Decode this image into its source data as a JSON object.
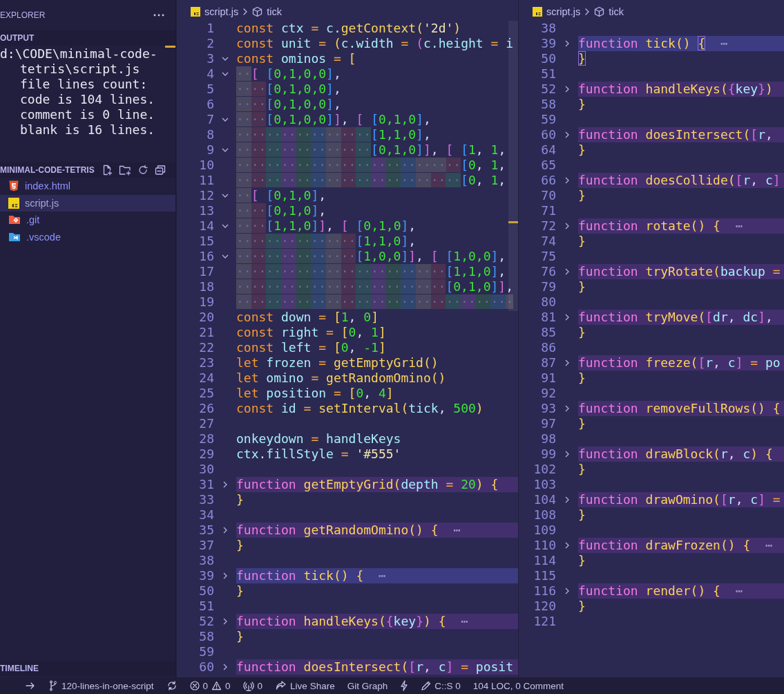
{
  "sidebar": {
    "title": "EXPLORER",
    "output": {
      "title": "OUTPUT",
      "lines": [
        "d:\\CODE\\minimal-code-",
        "tetris\\script.js",
        "file lines count:",
        "code is 104 lines.",
        "comment is 0 line.",
        "blank is 16 lines."
      ]
    },
    "folder": {
      "title": "MINIMAL-CODE-TETRIS",
      "items": [
        {
          "name": "index.html",
          "kind": "html",
          "selected": false
        },
        {
          "name": "script.js",
          "kind": "js",
          "selected": true
        },
        {
          "name": ".git",
          "kind": "git",
          "selected": false
        },
        {
          "name": ".vscode",
          "kind": "vscode",
          "selected": false
        }
      ]
    },
    "timeline": {
      "title": "TIMELINE"
    }
  },
  "editors": [
    {
      "breadcrumb": {
        "file": "script.js",
        "symbol": "tick"
      },
      "lines": [
        {
          "number": "1",
          "selected": false,
          "tokens": [
            {
              "text": "const ",
              "kind": "kw"
            },
            {
              "text": "ctx",
              "kind": "var"
            },
            {
              "text": " = ",
              "kind": "op"
            },
            {
              "text": "c.",
              "kind": "var"
            },
            {
              "text": "getContext",
              "kind": "call"
            },
            {
              "text": "(",
              "kind": "br0"
            },
            {
              "text": "'2d'",
              "kind": "str"
            },
            {
              "text": ")",
              "kind": "br0"
            }
          ]
        },
        {
          "number": "2",
          "selected": false,
          "tokens": [
            {
              "text": "const ",
              "kind": "kw"
            },
            {
              "text": "unit",
              "kind": "var"
            },
            {
              "text": " = ",
              "kind": "op"
            },
            {
              "text": "(",
              "kind": "br0"
            },
            {
              "text": "c.width",
              "kind": "var"
            },
            {
              "text": " = ",
              "kind": "op"
            },
            {
              "text": "(",
              "kind": "br1"
            },
            {
              "text": "c.height",
              "kind": "var"
            },
            {
              "text": " = ",
              "kind": "op"
            },
            {
              "text": "i",
              "kind": "var"
            }
          ]
        },
        {
          "number": "3",
          "selected": false,
          "folded": false,
          "tokens": [
            {
              "text": "const ",
              "kind": "kw"
            },
            {
              "text": "ominos",
              "kind": "var"
            },
            {
              "text": " = ",
              "kind": "op"
            },
            {
              "text": "[",
              "kind": "br0"
            }
          ]
        },
        {
          "number": "4",
          "selected": false,
          "folded": false,
          "tokens": [
            {
              "text": "··",
              "kind": "ws"
            },
            {
              "text": "[ ",
              "kind": "br1"
            },
            {
              "text": "[",
              "kind": "br2"
            },
            {
              "text": "0,1,0,0",
              "kind": "num"
            },
            {
              "text": "]",
              "kind": "br2"
            },
            {
              "text": ",",
              "kind": "punc"
            }
          ]
        },
        {
          "number": "5",
          "selected": false,
          "tokens": [
            {
              "text": "····",
              "kind": "ws"
            },
            {
              "text": "[",
              "kind": "br2"
            },
            {
              "text": "0,1,0,0",
              "kind": "num"
            },
            {
              "text": "]",
              "kind": "br2"
            },
            {
              "text": ",",
              "kind": "punc"
            }
          ]
        },
        {
          "number": "6",
          "selected": false,
          "tokens": [
            {
              "text": "····",
              "kind": "ws"
            },
            {
              "text": "[",
              "kind": "br2"
            },
            {
              "text": "0,1,0,0",
              "kind": "num"
            },
            {
              "text": "]",
              "kind": "br2"
            },
            {
              "text": ",",
              "kind": "punc"
            }
          ]
        },
        {
          "number": "7",
          "selected": false,
          "folded": false,
          "tokens": [
            {
              "text": "····",
              "kind": "ws"
            },
            {
              "text": "[",
              "kind": "br2"
            },
            {
              "text": "0,1,0,0",
              "kind": "num"
            },
            {
              "text": "]",
              "kind": "br2"
            },
            {
              "text": "]",
              "kind": "br1"
            },
            {
              "text": ", ",
              "kind": "punc"
            },
            {
              "text": "[ ",
              "kind": "br1"
            },
            {
              "text": "[",
              "kind": "br2"
            },
            {
              "text": "0,1,0",
              "kind": "num"
            },
            {
              "text": "]",
              "kind": "br2"
            },
            {
              "text": ",",
              "kind": "punc"
            }
          ]
        },
        {
          "number": "8",
          "selected": false,
          "tokens": [
            {
              "text": "··················",
              "kind": "ws"
            },
            {
              "text": "[",
              "kind": "br2"
            },
            {
              "text": "1,1,0",
              "kind": "num"
            },
            {
              "text": "]",
              "kind": "br2"
            },
            {
              "text": ",",
              "kind": "punc"
            }
          ]
        },
        {
          "number": "9",
          "selected": false,
          "folded": false,
          "tokens": [
            {
              "text": "··················",
              "kind": "ws"
            },
            {
              "text": "[",
              "kind": "br2"
            },
            {
              "text": "0,1,0",
              "kind": "num"
            },
            {
              "text": "]",
              "kind": "br2"
            },
            {
              "text": "]",
              "kind": "br1"
            },
            {
              "text": ", ",
              "kind": "punc"
            },
            {
              "text": "[ ",
              "kind": "br1"
            },
            {
              "text": "[",
              "kind": "br2"
            },
            {
              "text": "1",
              "kind": "num"
            },
            {
              "text": ", ",
              "kind": "punc"
            },
            {
              "text": "1",
              "kind": "num"
            },
            {
              "text": ",",
              "kind": "punc"
            }
          ]
        },
        {
          "number": "10",
          "selected": false,
          "tokens": [
            {
              "text": "··························",
              "kind": "ws"
            },
            {
              "text": "····",
              "kind": "ws"
            },
            {
              "text": "[",
              "kind": "br2"
            },
            {
              "text": "0",
              "kind": "num"
            },
            {
              "text": ", ",
              "kind": "punc"
            },
            {
              "text": "1",
              "kind": "num"
            },
            {
              "text": ",",
              "kind": "punc"
            }
          ]
        },
        {
          "number": "11",
          "selected": false,
          "tokens": [
            {
              "text": "······························",
              "kind": "ws"
            },
            {
              "text": "[",
              "kind": "br2"
            },
            {
              "text": "0",
              "kind": "num"
            },
            {
              "text": ", ",
              "kind": "punc"
            },
            {
              "text": "1",
              "kind": "num"
            },
            {
              "text": ",",
              "kind": "punc"
            }
          ]
        },
        {
          "number": "12",
          "selected": false,
          "folded": false,
          "tokens": [
            {
              "text": "··",
              "kind": "ws"
            },
            {
              "text": "[ ",
              "kind": "br1"
            },
            {
              "text": "[",
              "kind": "br2"
            },
            {
              "text": "0,1,0",
              "kind": "num"
            },
            {
              "text": "]",
              "kind": "br2"
            },
            {
              "text": ",",
              "kind": "punc"
            }
          ]
        },
        {
          "number": "13",
          "selected": false,
          "tokens": [
            {
              "text": "····",
              "kind": "ws"
            },
            {
              "text": "[",
              "kind": "br2"
            },
            {
              "text": "0,1,0",
              "kind": "num"
            },
            {
              "text": "]",
              "kind": "br2"
            },
            {
              "text": ",",
              "kind": "punc"
            }
          ]
        },
        {
          "number": "14",
          "selected": false,
          "folded": false,
          "tokens": [
            {
              "text": "····",
              "kind": "ws"
            },
            {
              "text": "[",
              "kind": "br2"
            },
            {
              "text": "1,1,0",
              "kind": "num"
            },
            {
              "text": "]",
              "kind": "br2"
            },
            {
              "text": "]",
              "kind": "br1"
            },
            {
              "text": ", ",
              "kind": "punc"
            },
            {
              "text": "[ ",
              "kind": "br1"
            },
            {
              "text": "[",
              "kind": "br2"
            },
            {
              "text": "0,1,0",
              "kind": "num"
            },
            {
              "text": "]",
              "kind": "br2"
            },
            {
              "text": ",",
              "kind": "punc"
            }
          ]
        },
        {
          "number": "15",
          "selected": false,
          "tokens": [
            {
              "text": "················",
              "kind": "ws"
            },
            {
              "text": "[",
              "kind": "br2"
            },
            {
              "text": "1,1,0",
              "kind": "num"
            },
            {
              "text": "]",
              "kind": "br2"
            },
            {
              "text": ",",
              "kind": "punc"
            }
          ]
        },
        {
          "number": "16",
          "selected": false,
          "folded": false,
          "tokens": [
            {
              "text": "················",
              "kind": "ws"
            },
            {
              "text": "[",
              "kind": "br2"
            },
            {
              "text": "1,0,0",
              "kind": "num"
            },
            {
              "text": "]",
              "kind": "br2"
            },
            {
              "text": "]",
              "kind": "br1"
            },
            {
              "text": ", ",
              "kind": "punc"
            },
            {
              "text": "[ ",
              "kind": "br1"
            },
            {
              "text": "[",
              "kind": "br2"
            },
            {
              "text": "1,0,0",
              "kind": "num"
            },
            {
              "text": "]",
              "kind": "br2"
            },
            {
              "text": ",",
              "kind": "punc"
            }
          ]
        },
        {
          "number": "17",
          "selected": false,
          "tokens": [
            {
              "text": "····························",
              "kind": "ws"
            },
            {
              "text": "[",
              "kind": "br2"
            },
            {
              "text": "1,1,0",
              "kind": "num"
            },
            {
              "text": "]",
              "kind": "br2"
            },
            {
              "text": ",",
              "kind": "punc"
            }
          ]
        },
        {
          "number": "18",
          "selected": false,
          "tokens": [
            {
              "text": "····························",
              "kind": "ws"
            },
            {
              "text": "[",
              "kind": "br2"
            },
            {
              "text": "0,1,0",
              "kind": "num"
            },
            {
              "text": "]",
              "kind": "br2"
            },
            {
              "text": "]",
              "kind": "br1"
            },
            {
              "text": ",",
              "kind": "punc"
            }
          ]
        },
        {
          "number": "19",
          "selected": false,
          "tokens": [
            {
              "text": "·····································",
              "kind": "ws"
            }
          ]
        },
        {
          "number": "20",
          "selected": false,
          "tokens": [
            {
              "text": "const ",
              "kind": "kw"
            },
            {
              "text": "down",
              "kind": "var"
            },
            {
              "text": " = ",
              "kind": "op"
            },
            {
              "text": "[",
              "kind": "br0"
            },
            {
              "text": "1",
              "kind": "num"
            },
            {
              "text": ", ",
              "kind": "punc"
            },
            {
              "text": "0",
              "kind": "num"
            },
            {
              "text": "]",
              "kind": "br0"
            }
          ]
        },
        {
          "number": "21",
          "selected": false,
          "tokens": [
            {
              "text": "const ",
              "kind": "kw"
            },
            {
              "text": "right",
              "kind": "var"
            },
            {
              "text": " = ",
              "kind": "op"
            },
            {
              "text": "[",
              "kind": "br0"
            },
            {
              "text": "0",
              "kind": "num"
            },
            {
              "text": ", ",
              "kind": "punc"
            },
            {
              "text": "1",
              "kind": "num"
            },
            {
              "text": "]",
              "kind": "br0"
            }
          ]
        },
        {
          "number": "22",
          "selected": false,
          "tokens": [
            {
              "text": "const ",
              "kind": "kw"
            },
            {
              "text": "left",
              "kind": "var"
            },
            {
              "text": " = ",
              "kind": "op"
            },
            {
              "text": "[",
              "kind": "br0"
            },
            {
              "text": "0",
              "kind": "num"
            },
            {
              "text": ", ",
              "kind": "punc"
            },
            {
              "text": "-1",
              "kind": "num"
            },
            {
              "text": "]",
              "kind": "br0"
            }
          ]
        },
        {
          "number": "23",
          "selected": false,
          "tokens": [
            {
              "text": "let ",
              "kind": "kw"
            },
            {
              "text": "frozen",
              "kind": "var"
            },
            {
              "text": " = ",
              "kind": "op"
            },
            {
              "text": "getEmptyGrid",
              "kind": "call"
            },
            {
              "text": "()",
              "kind": "br0"
            }
          ]
        },
        {
          "number": "24",
          "selected": false,
          "tokens": [
            {
              "text": "let ",
              "kind": "kw"
            },
            {
              "text": "omino",
              "kind": "var"
            },
            {
              "text": " = ",
              "kind": "op"
            },
            {
              "text": "getRandomOmino",
              "kind": "call"
            },
            {
              "text": "()",
              "kind": "br0"
            }
          ]
        },
        {
          "number": "25",
          "selected": false,
          "tokens": [
            {
              "text": "let ",
              "kind": "kw"
            },
            {
              "text": "position",
              "kind": "var"
            },
            {
              "text": " = ",
              "kind": "op"
            },
            {
              "text": "[",
              "kind": "br0"
            },
            {
              "text": "0",
              "kind": "num"
            },
            {
              "text": ", ",
              "kind": "punc"
            },
            {
              "text": "4",
              "kind": "num"
            },
            {
              "text": "]",
              "kind": "br0"
            }
          ]
        },
        {
          "number": "26",
          "selected": false,
          "tokens": [
            {
              "text": "const ",
              "kind": "kw"
            },
            {
              "text": "id",
              "kind": "var"
            },
            {
              "text": " = ",
              "kind": "op"
            },
            {
              "text": "setInterval",
              "kind": "call"
            },
            {
              "text": "(",
              "kind": "br0"
            },
            {
              "text": "tick",
              "kind": "var"
            },
            {
              "text": ", ",
              "kind": "punc"
            },
            {
              "text": "500",
              "kind": "num"
            },
            {
              "text": ")",
              "kind": "br0"
            }
          ]
        },
        {
          "number": "27",
          "selected": false
        },
        {
          "number": "28",
          "selected": false,
          "tokens": [
            {
              "text": "onkeydown",
              "kind": "var"
            },
            {
              "text": " = ",
              "kind": "op"
            },
            {
              "text": "handleKeys",
              "kind": "var"
            }
          ]
        },
        {
          "number": "29",
          "selected": false,
          "tokens": [
            {
              "text": "ctx",
              "kind": "var"
            },
            {
              "text": ".",
              "kind": "punc"
            },
            {
              "text": "fillStyle",
              "kind": "var"
            },
            {
              "text": " = ",
              "kind": "op"
            },
            {
              "text": "'#555'",
              "kind": "str"
            }
          ]
        },
        {
          "number": "30",
          "selected": false
        },
        {
          "number": "31",
          "selected": false,
          "folded": true,
          "tokens": [
            {
              "text": "function ",
              "kind": "fn"
            },
            {
              "text": "getEmptyGrid",
              "kind": "call"
            },
            {
              "text": "(",
              "kind": "br0"
            },
            {
              "text": "depth",
              "kind": "var"
            },
            {
              "text": " = ",
              "kind": "op"
            },
            {
              "text": "20",
              "kind": "num"
            },
            {
              "text": ")",
              "kind": "br0"
            },
            {
              "text": " {",
              "kind": "br0"
            }
          ]
        },
        {
          "number": "33",
          "selected": false,
          "tokens": [
            {
              "text": "}",
              "kind": "br0"
            }
          ]
        },
        {
          "number": "34",
          "selected": false
        },
        {
          "number": "35",
          "selected": false,
          "folded": true,
          "tokens": [
            {
              "text": "function ",
              "kind": "fn"
            },
            {
              "text": "getRandomOmino",
              "kind": "call"
            },
            {
              "text": "()",
              "kind": "br0"
            },
            {
              "text": " {",
              "kind": "br0"
            },
            {
              "text": "  ⋯",
              "kind": "ell"
            }
          ]
        },
        {
          "number": "37",
          "selected": false,
          "tokens": [
            {
              "text": "}",
              "kind": "br0"
            }
          ]
        },
        {
          "number": "38",
          "selected": false
        },
        {
          "number": "39",
          "selected": true,
          "folded": true,
          "tokens": [
            {
              "text": "function ",
              "kind": "fn"
            },
            {
              "text": "tick",
              "kind": "call"
            },
            {
              "text": "()",
              "kind": "br0"
            },
            {
              "text": " {",
              "kind": "br0"
            },
            {
              "text": "  ⋯",
              "kind": "ell"
            }
          ]
        },
        {
          "number": "50",
          "selected": false,
          "tokens": [
            {
              "text": "}",
              "kind": "br0"
            }
          ]
        },
        {
          "number": "51",
          "selected": false
        },
        {
          "number": "52",
          "selected": false,
          "folded": true,
          "tokens": [
            {
              "text": "function ",
              "kind": "fn"
            },
            {
              "text": "handleKeys",
              "kind": "call"
            },
            {
              "text": "(",
              "kind": "br0"
            },
            {
              "text": "{",
              "kind": "br1"
            },
            {
              "text": "key",
              "kind": "var"
            },
            {
              "text": "}",
              "kind": "br1"
            },
            {
              "text": ")",
              "kind": "br0"
            },
            {
              "text": " {",
              "kind": "br0"
            },
            {
              "text": "  ⋯",
              "kind": "ell"
            }
          ]
        },
        {
          "number": "58",
          "selected": false,
          "tokens": [
            {
              "text": "}",
              "kind": "br0"
            }
          ]
        },
        {
          "number": "59",
          "selected": false
        },
        {
          "number": "60",
          "selected": false,
          "folded": true,
          "tokens": [
            {
              "text": "function ",
              "kind": "fn"
            },
            {
              "text": "doesIntersect",
              "kind": "call"
            },
            {
              "text": "(",
              "kind": "br0"
            },
            {
              "text": "[",
              "kind": "br1"
            },
            {
              "text": "r",
              "kind": "var"
            },
            {
              "text": ", ",
              "kind": "punc"
            },
            {
              "text": "c",
              "kind": "var"
            },
            {
              "text": "]",
              "kind": "br1"
            },
            {
              "text": " = ",
              "kind": "op"
            },
            {
              "text": "posit",
              "kind": "var"
            }
          ]
        }
      ]
    },
    {
      "breadcrumb": {
        "file": "script.js",
        "symbol": "tick"
      },
      "lines": [
        {
          "number": "38",
          "selected": false
        },
        {
          "number": "39",
          "selected": true,
          "folded": true,
          "tokens": [
            {
              "text": "function ",
              "kind": "fn"
            },
            {
              "text": "tick",
              "kind": "call"
            },
            {
              "text": "() ",
              "kind": "br0"
            },
            {
              "text": "{",
              "kind": "match"
            },
            {
              "text": "  ⋯",
              "kind": "ell"
            }
          ]
        },
        {
          "number": "50",
          "selected": false,
          "tokens": [
            {
              "text": "}",
              "kind": "match"
            }
          ]
        },
        {
          "number": "51",
          "selected": false
        },
        {
          "number": "52",
          "selected": false,
          "folded": true,
          "tokens": [
            {
              "text": "function ",
              "kind": "fn"
            },
            {
              "text": "handleKeys",
              "kind": "call"
            },
            {
              "text": "(",
              "kind": "br0"
            },
            {
              "text": "{",
              "kind": "br1"
            },
            {
              "text": "key",
              "kind": "var"
            },
            {
              "text": "}",
              "kind": "br1"
            },
            {
              "text": ")",
              "kind": "br0"
            }
          ]
        },
        {
          "number": "58",
          "selected": false,
          "tokens": [
            {
              "text": "}",
              "kind": "br0"
            }
          ]
        },
        {
          "number": "59",
          "selected": false
        },
        {
          "number": "60",
          "selected": false,
          "folded": true,
          "tokens": [
            {
              "text": "function ",
              "kind": "fn"
            },
            {
              "text": "doesIntersect",
              "kind": "call"
            },
            {
              "text": "(",
              "kind": "br0"
            },
            {
              "text": "[",
              "kind": "br1"
            },
            {
              "text": "r",
              "kind": "var"
            },
            {
              "text": ",",
              "kind": "punc"
            }
          ]
        },
        {
          "number": "64",
          "selected": false,
          "tokens": [
            {
              "text": "}",
              "kind": "br0"
            }
          ]
        },
        {
          "number": "65",
          "selected": false
        },
        {
          "number": "66",
          "selected": false,
          "folded": true,
          "tokens": [
            {
              "text": "function ",
              "kind": "fn"
            },
            {
              "text": "doesCollide",
              "kind": "call"
            },
            {
              "text": "(",
              "kind": "br0"
            },
            {
              "text": "[",
              "kind": "br1"
            },
            {
              "text": "r",
              "kind": "var"
            },
            {
              "text": ", ",
              "kind": "punc"
            },
            {
              "text": "c",
              "kind": "var"
            },
            {
              "text": "]",
              "kind": "br1"
            }
          ]
        },
        {
          "number": "70",
          "selected": false,
          "tokens": [
            {
              "text": "}",
              "kind": "br0"
            }
          ]
        },
        {
          "number": "71",
          "selected": false
        },
        {
          "number": "72",
          "selected": false,
          "folded": true,
          "tokens": [
            {
              "text": "function ",
              "kind": "fn"
            },
            {
              "text": "rotate",
              "kind": "call"
            },
            {
              "text": "()",
              "kind": "br0"
            },
            {
              "text": " {",
              "kind": "br0"
            },
            {
              "text": "  ⋯",
              "kind": "ell"
            }
          ]
        },
        {
          "number": "74",
          "selected": false,
          "tokens": [
            {
              "text": "}",
              "kind": "br0"
            }
          ]
        },
        {
          "number": "75",
          "selected": false
        },
        {
          "number": "76",
          "selected": false,
          "folded": true,
          "tokens": [
            {
              "text": "function ",
              "kind": "fn"
            },
            {
              "text": "tryRotate",
              "kind": "call"
            },
            {
              "text": "(",
              "kind": "br0"
            },
            {
              "text": "backup",
              "kind": "var"
            },
            {
              "text": " =",
              "kind": "op"
            }
          ]
        },
        {
          "number": "79",
          "selected": false,
          "tokens": [
            {
              "text": "}",
              "kind": "br0"
            }
          ]
        },
        {
          "number": "80",
          "selected": false
        },
        {
          "number": "81",
          "selected": false,
          "folded": true,
          "tokens": [
            {
              "text": "function ",
              "kind": "fn"
            },
            {
              "text": "tryMove",
              "kind": "call"
            },
            {
              "text": "(",
              "kind": "br0"
            },
            {
              "text": "[",
              "kind": "br1"
            },
            {
              "text": "dr",
              "kind": "var"
            },
            {
              "text": ", ",
              "kind": "punc"
            },
            {
              "text": "dc",
              "kind": "var"
            },
            {
              "text": "]",
              "kind": "br1"
            },
            {
              "text": ",",
              "kind": "punc"
            }
          ]
        },
        {
          "number": "85",
          "selected": false,
          "tokens": [
            {
              "text": "}",
              "kind": "br0"
            }
          ]
        },
        {
          "number": "86",
          "selected": false
        },
        {
          "number": "87",
          "selected": false,
          "folded": true,
          "tokens": [
            {
              "text": "function ",
              "kind": "fn"
            },
            {
              "text": "freeze",
              "kind": "call"
            },
            {
              "text": "(",
              "kind": "br0"
            },
            {
              "text": "[",
              "kind": "br1"
            },
            {
              "text": "r",
              "kind": "var"
            },
            {
              "text": ", ",
              "kind": "punc"
            },
            {
              "text": "c",
              "kind": "var"
            },
            {
              "text": "]",
              "kind": "br1"
            },
            {
              "text": " = ",
              "kind": "op"
            },
            {
              "text": "po",
              "kind": "var"
            }
          ]
        },
        {
          "number": "91",
          "selected": false,
          "tokens": [
            {
              "text": "}",
              "kind": "br0"
            }
          ]
        },
        {
          "number": "92",
          "selected": false
        },
        {
          "number": "93",
          "selected": false,
          "folded": true,
          "tokens": [
            {
              "text": "function ",
              "kind": "fn"
            },
            {
              "text": "removeFullRows",
              "kind": "call"
            },
            {
              "text": "()",
              "kind": "br0"
            },
            {
              "text": " {",
              "kind": "br0"
            }
          ]
        },
        {
          "number": "97",
          "selected": false,
          "tokens": [
            {
              "text": "}",
              "kind": "br0"
            }
          ]
        },
        {
          "number": "98",
          "selected": false
        },
        {
          "number": "99",
          "selected": false,
          "folded": true,
          "tokens": [
            {
              "text": "function ",
              "kind": "fn"
            },
            {
              "text": "drawBlock",
              "kind": "call"
            },
            {
              "text": "(",
              "kind": "br0"
            },
            {
              "text": "r",
              "kind": "var"
            },
            {
              "text": ", ",
              "kind": "punc"
            },
            {
              "text": "c",
              "kind": "var"
            },
            {
              "text": ")",
              "kind": "br0"
            },
            {
              "text": " {",
              "kind": "br0"
            }
          ]
        },
        {
          "number": "102",
          "selected": false,
          "tokens": [
            {
              "text": "}",
              "kind": "br0"
            }
          ]
        },
        {
          "number": "103",
          "selected": false
        },
        {
          "number": "104",
          "selected": false,
          "folded": true,
          "tokens": [
            {
              "text": "function ",
              "kind": "fn"
            },
            {
              "text": "drawOmino",
              "kind": "call"
            },
            {
              "text": "(",
              "kind": "br0"
            },
            {
              "text": "[",
              "kind": "br1"
            },
            {
              "text": "r",
              "kind": "var"
            },
            {
              "text": ", ",
              "kind": "punc"
            },
            {
              "text": "c",
              "kind": "var"
            },
            {
              "text": "]",
              "kind": "br1"
            },
            {
              "text": " =",
              "kind": "op"
            }
          ]
        },
        {
          "number": "108",
          "selected": false,
          "tokens": [
            {
              "text": "}",
              "kind": "br0"
            }
          ]
        },
        {
          "number": "109",
          "selected": false
        },
        {
          "number": "110",
          "selected": false,
          "folded": true,
          "tokens": [
            {
              "text": "function ",
              "kind": "fn"
            },
            {
              "text": "drawFrozen",
              "kind": "call"
            },
            {
              "text": "()",
              "kind": "br0"
            },
            {
              "text": " {",
              "kind": "br0"
            },
            {
              "text": "  ⋯",
              "kind": "ell"
            }
          ]
        },
        {
          "number": "114",
          "selected": false,
          "tokens": [
            {
              "text": "}",
              "kind": "br0"
            }
          ]
        },
        {
          "number": "115",
          "selected": false
        },
        {
          "number": "116",
          "selected": false,
          "folded": true,
          "tokens": [
            {
              "text": "function ",
              "kind": "fn"
            },
            {
              "text": "render",
              "kind": "call"
            },
            {
              "text": "()",
              "kind": "br0"
            },
            {
              "text": " {",
              "kind": "br0"
            },
            {
              "text": "  ⋯",
              "kind": "ell"
            }
          ]
        },
        {
          "number": "120",
          "selected": false,
          "tokens": [
            {
              "text": "}",
              "kind": "br0"
            }
          ]
        },
        {
          "number": "121",
          "selected": false
        }
      ]
    }
  ],
  "status_bar": {
    "items": [
      {
        "kind": "arrow"
      },
      {
        "kind": "branch",
        "text": "120-lines-in-one-script"
      },
      {
        "kind": "sync"
      },
      {
        "kind": "problems",
        "errors": "0",
        "warnings": "0"
      },
      {
        "kind": "broadcast",
        "text": "0"
      },
      {
        "kind": "liveshare",
        "text": "Live Share"
      },
      {
        "kind": "plain",
        "text": "Git Graph"
      },
      {
        "kind": "bolt"
      },
      {
        "kind": "pencil",
        "text": "C::S 0"
      },
      {
        "kind": "plain",
        "text": "104 LOC, 0 Comment"
      }
    ]
  }
}
